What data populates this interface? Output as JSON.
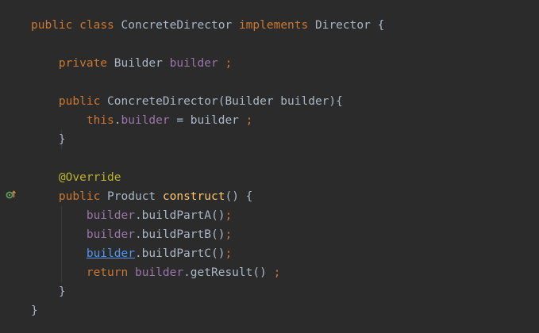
{
  "editor": {
    "lines": [
      {
        "tokens": [
          "public",
          "class",
          "ConcreteDirector",
          "implements",
          "Director",
          "{"
        ]
      },
      {
        "tokens": []
      },
      {
        "tokens": [
          "private",
          "Builder",
          "builder",
          ";"
        ]
      },
      {
        "tokens": []
      },
      {
        "tokens": [
          "public",
          "ConcreteDirector(Builder builder){"
        ]
      },
      {
        "tokens": [
          "this",
          ".",
          "builder",
          " = builder ",
          ";"
        ]
      },
      {
        "tokens": [
          "}"
        ]
      },
      {
        "tokens": []
      },
      {
        "tokens": [
          "@Override"
        ]
      },
      {
        "tokens": [
          "public",
          "Product",
          "construct",
          "() {"
        ]
      },
      {
        "tokens": [
          "builder",
          ".buildPartA()",
          ";"
        ]
      },
      {
        "tokens": [
          "builder",
          ".buildPartB()",
          ";"
        ]
      },
      {
        "tokens": [
          "builder",
          ".buildPartC()",
          ";"
        ]
      },
      {
        "tokens": [
          "return",
          "builder",
          ".getResult() ",
          ";"
        ]
      },
      {
        "tokens": [
          "}"
        ]
      },
      {
        "tokens": [
          "}"
        ]
      }
    ]
  },
  "gutter": {
    "override_marker_icon": "implements-override-icon"
  },
  "colors": {
    "background": "#2b2b2b",
    "keyword": "#cc7832",
    "field": "#9876aa",
    "annotation": "#bbb529",
    "method": "#ffc66d",
    "text": "#a9b7c6",
    "link": "#5394ec",
    "marker_green": "#5fa35f",
    "marker_arrow": "#d98c3f"
  }
}
